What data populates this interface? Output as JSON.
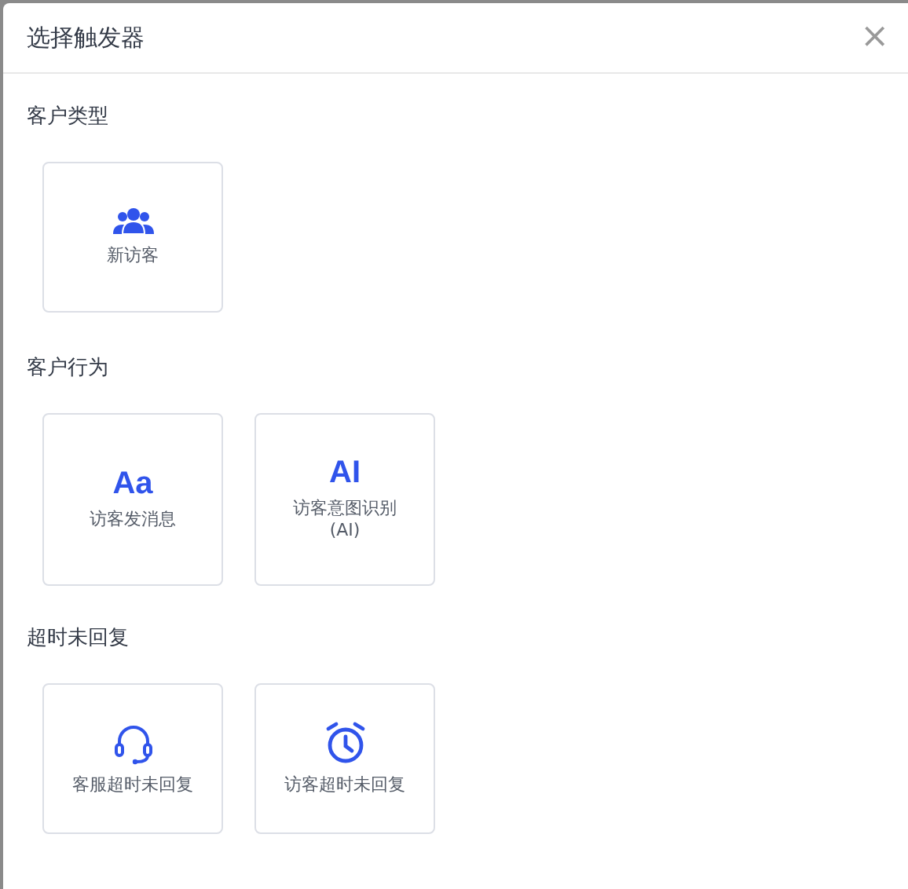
{
  "dialog": {
    "title": "选择触发器",
    "close": "×"
  },
  "sections": [
    {
      "label": "客户类型",
      "cards": [
        {
          "kind": "users",
          "label": "新访客"
        }
      ]
    },
    {
      "label": "客户行为",
      "cards": [
        {
          "kind": "glyph",
          "glyph": "Aa",
          "label": "访客发消息"
        },
        {
          "kind": "glyph",
          "glyph": "AI",
          "label": "访客意图识别\n(AI)"
        }
      ]
    },
    {
      "label": "超时未回复",
      "cards": [
        {
          "kind": "headset",
          "label": "客服超时未回复"
        },
        {
          "kind": "alarm",
          "label": "访客超时未回复"
        }
      ]
    }
  ]
}
